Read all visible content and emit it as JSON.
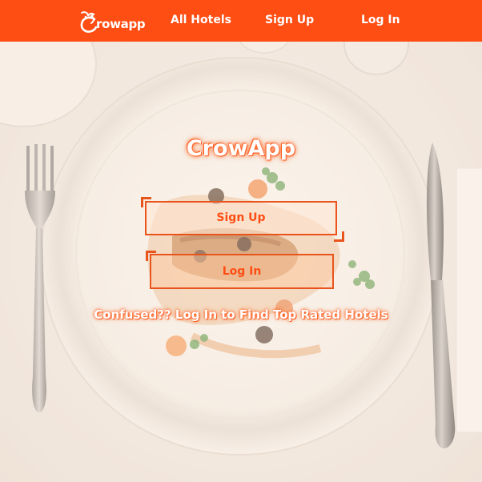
{
  "navbar": {
    "logo_text": "rowapp",
    "links": [
      {
        "label": "All Hotels"
      },
      {
        "label": "Sign Up"
      },
      {
        "label": "Log In"
      }
    ]
  },
  "hero": {
    "title": "CrowApp",
    "signup_label": "Sign Up",
    "login_label": "Log In",
    "tagline": "Confused?? Log In to Find Top Rated Hotels"
  },
  "colors": {
    "brand": "#ff4e14",
    "button_border": "#e8541c",
    "text_light": "#ffffff"
  },
  "icons": {
    "logo": "crow-bird-icon"
  }
}
